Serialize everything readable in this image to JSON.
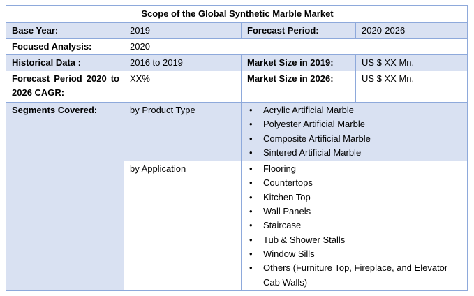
{
  "title": "Scope of the Global Synthetic Marble Market",
  "rows": {
    "base_year_label": "Base Year:",
    "base_year_value": "2019",
    "forecast_period_label": "Forecast Period:",
    "forecast_period_value": "2020-2026",
    "focused_analysis_label": "Focused Analysis:",
    "focused_analysis_value": "2020",
    "historical_data_label": "Historical Data :",
    "historical_data_value": "2016 to 2019",
    "market_size_2019_label": "Market Size in 2019:",
    "market_size_2019_value": "US $ XX Mn.",
    "cagr_label": "Forecast Period 2020 to 2026 CAGR:",
    "cagr_value": "XX%",
    "market_size_2026_label": "Market Size in 2026:",
    "market_size_2026_value": "US $ XX Mn."
  },
  "segments": {
    "label": "Segments Covered:",
    "groups": [
      {
        "name": "by Product Type",
        "items": [
          "Acrylic Artificial Marble",
          "Polyester Artificial Marble",
          "Composite Artificial Marble",
          "Sintered Artificial Marble"
        ]
      },
      {
        "name": "by Application",
        "items": [
          "Flooring",
          "Countertops",
          "Kitchen Top",
          "Wall Panels",
          "Staircase",
          "Tub & Shower Stalls",
          "Window Sills",
          "Others (Furniture Top, Fireplace, and Elevator Cab Walls)"
        ]
      }
    ]
  },
  "bullet_glyph": "•",
  "colors": {
    "shade": "#d9e1f2",
    "border": "#8ea9db"
  }
}
